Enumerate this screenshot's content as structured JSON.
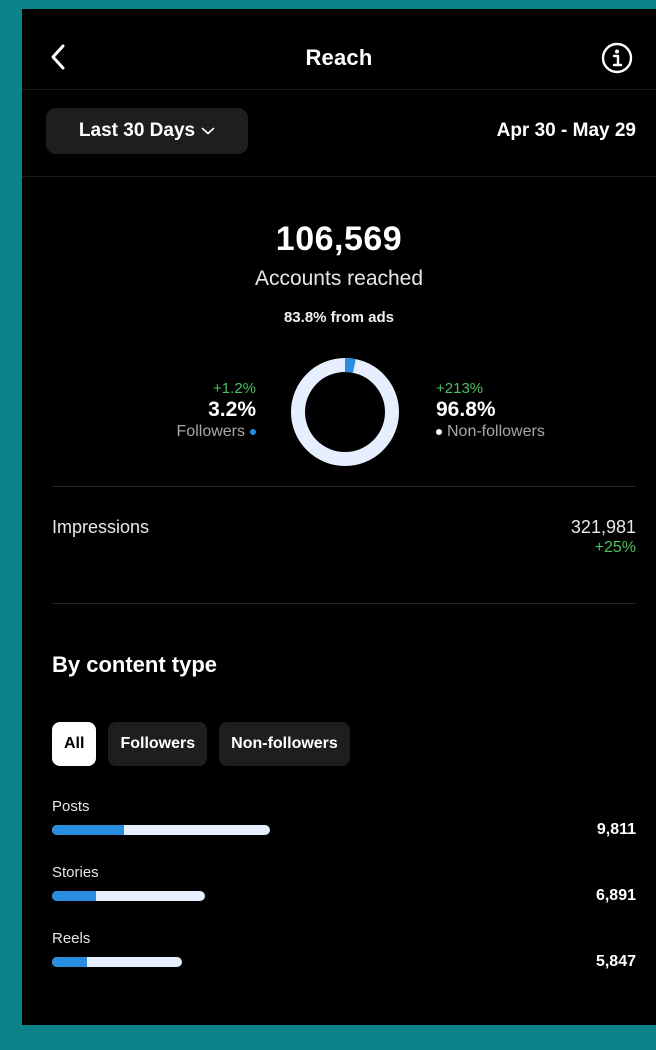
{
  "header": {
    "title": "Reach",
    "back_icon": "chevron-left-icon",
    "info_icon": "info-icon"
  },
  "date_range": {
    "selected": "Last 30 Days",
    "chevron_icon": "chevron-down-icon",
    "dates": "Apr 30 - May 29"
  },
  "summary": {
    "accounts_reached_value": "106,569",
    "accounts_reached_label": "Accounts reached",
    "ads_note": "83.8% from ads"
  },
  "audience_split": {
    "followers": {
      "change": "+1.2%",
      "percent": "3.2%",
      "label": "Followers",
      "share": 0.032,
      "color": "#2b8ddf"
    },
    "non_followers": {
      "change": "+213%",
      "percent": "96.8%",
      "label": "Non-followers",
      "share": 0.968,
      "color": "#e6efff"
    }
  },
  "impressions": {
    "label": "Impressions",
    "value": "321,981",
    "change": "+25%"
  },
  "content_type": {
    "title": "By content type",
    "filters": [
      "All",
      "Followers",
      "Non-followers"
    ],
    "active_filter": "All",
    "items": [
      {
        "label": "Posts",
        "value": "9,811",
        "total": 9811,
        "followers_share": 0.33
      },
      {
        "label": "Stories",
        "value": "6,891",
        "total": 6891,
        "followers_share": 0.29
      },
      {
        "label": "Reels",
        "value": "5,847",
        "total": 5847,
        "followers_share": 0.27
      }
    ]
  },
  "colors": {
    "accent_blue": "#2b8ddf",
    "positive_green": "#4cc15f",
    "background": "#000000",
    "frame": "#0a8489"
  }
}
